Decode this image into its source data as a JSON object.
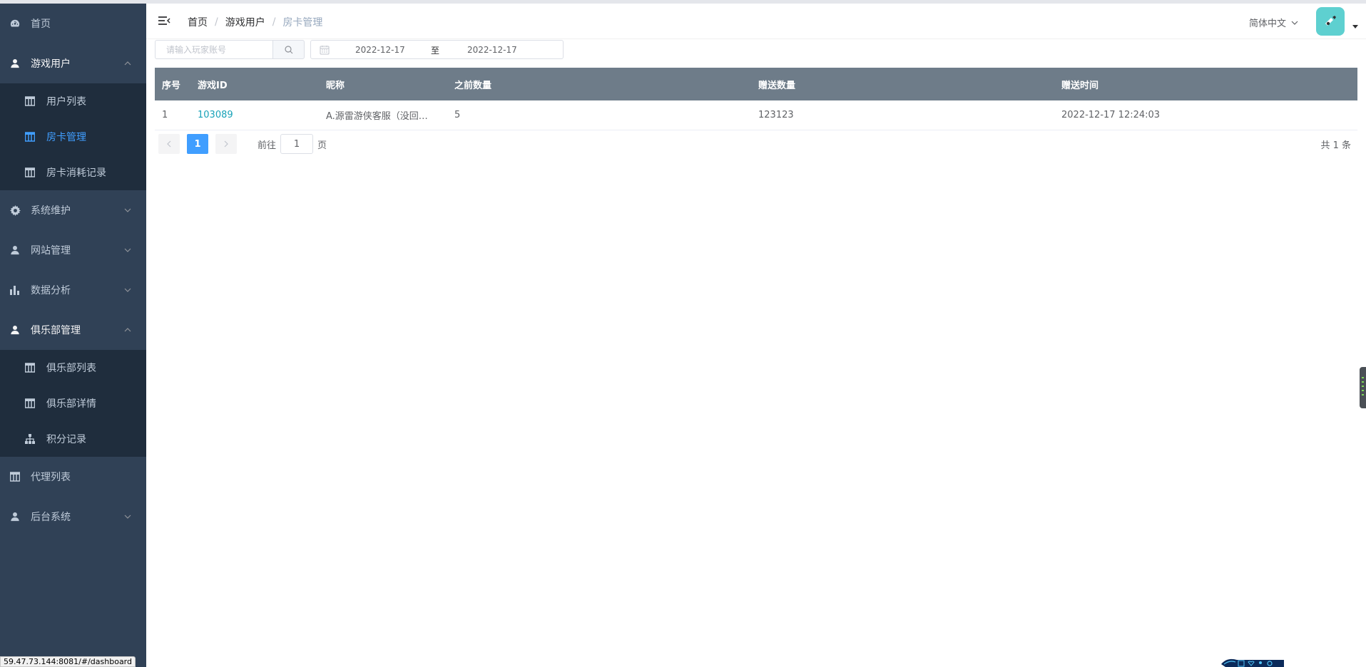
{
  "sidebar": {
    "items": [
      {
        "label": "首页",
        "icon": "dashboard-icon"
      },
      {
        "label": "游戏用户",
        "icon": "user-icon",
        "open": true,
        "children": [
          {
            "label": "用户列表",
            "icon": "table-icon"
          },
          {
            "label": "房卡管理",
            "icon": "table-icon",
            "active": true
          },
          {
            "label": "房卡消耗记录",
            "icon": "table-icon"
          }
        ]
      },
      {
        "label": "系统维护",
        "icon": "gear-icon"
      },
      {
        "label": "网站管理",
        "icon": "user-icon"
      },
      {
        "label": "数据分析",
        "icon": "bar-chart-icon"
      },
      {
        "label": "俱乐部管理",
        "icon": "user-icon",
        "open": true,
        "children": [
          {
            "label": "俱乐部列表",
            "icon": "table-icon"
          },
          {
            "label": "俱乐部详情",
            "icon": "table-icon"
          },
          {
            "label": "积分记录",
            "icon": "tree-icon"
          }
        ]
      },
      {
        "label": "代理列表",
        "icon": "table-icon"
      },
      {
        "label": "后台系统",
        "icon": "user-icon"
      }
    ]
  },
  "header": {
    "breadcrumb": [
      "首页",
      "游戏用户",
      "房卡管理"
    ],
    "language": "简体中文"
  },
  "toolbar": {
    "search_placeholder": "请输入玩家账号",
    "date_start": "2022-12-17",
    "date_separator": "至",
    "date_end": "2022-12-17"
  },
  "table": {
    "columns": [
      "序号",
      "游戏ID",
      "昵称",
      "之前数量",
      "赠送数量",
      "赠送时间"
    ],
    "rows": [
      [
        "1",
        "103089",
        "A.源雷游侠客服（没回…",
        "5",
        "123123",
        "2022-12-17 12:24:03"
      ]
    ]
  },
  "pagination": {
    "current_page": "1",
    "goto_prefix": "前往",
    "goto_value": "1",
    "goto_suffix": "页",
    "total": "共 1 条"
  },
  "statusbar": {
    "url": "59.47.73.144:8081/#/dashboard"
  },
  "colors": {
    "sidebar_bg": "#304156",
    "submenu_bg": "#1f2d3d",
    "active": "#409eff",
    "table_header": "#6e7c89",
    "link": "#17a2b8",
    "avatar": "#5ed0d0"
  }
}
